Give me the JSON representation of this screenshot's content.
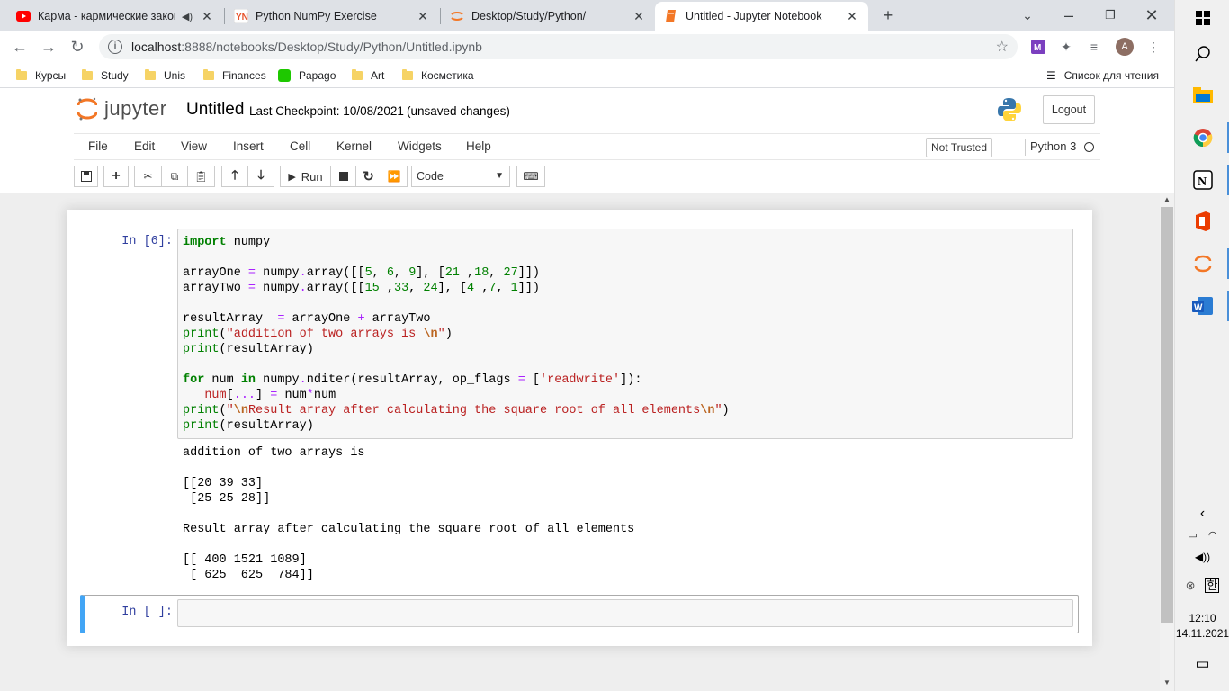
{
  "browser": {
    "tabs": [
      {
        "title": "Карма - кармические закон",
        "icon": "youtube-icon",
        "active": false
      },
      {
        "title": "Python NumPy Exercise",
        "icon": "pynative-icon",
        "active": false
      },
      {
        "title": "Desktop/Study/Python/",
        "icon": "jupyter-icon",
        "active": false
      },
      {
        "title": "Untitled - Jupyter Notebook",
        "icon": "notebook-icon",
        "active": true
      }
    ],
    "url_host": "localhost",
    "url_rest": ":8888/notebooks/Desktop/Study/Python/Untitled.ipynb",
    "avatar_letter": "A",
    "bookmarks": [
      "Курсы",
      "Study",
      "Unis",
      "Finances",
      "Papago",
      "Art",
      "Косметика"
    ],
    "reading_list": "Список для чтения"
  },
  "jupyter": {
    "logo_text": "jupyter",
    "notebook_name": "Untitled",
    "checkpoint": "Last Checkpoint: 10/08/2021",
    "unsaved": "(unsaved changes)",
    "logout": "Logout",
    "menu": [
      "File",
      "Edit",
      "View",
      "Insert",
      "Cell",
      "Kernel",
      "Widgets",
      "Help"
    ],
    "trust": "Not Trusted",
    "kernel": "Python 3",
    "run_label": "Run",
    "cell_type": "Code"
  },
  "cells": [
    {
      "prompt": "In [6]:",
      "output": "addition of two arrays is\n\n[[20 39 33]\n [25 25 28]]\n\nResult array after calculating the square root of all elements\n\n[[ 400 1521 1089]\n [ 625  625  784]]"
    },
    {
      "prompt": "In [ ]:"
    }
  ],
  "taskbar": {
    "time": "12:10",
    "date": "14.11.2021",
    "ime": "한"
  },
  "colors": {
    "prompt_blue": "#303f9f",
    "selected_cell_accent": "#42a5f5",
    "keyword_green": "#008000",
    "string_red": "#ba2121"
  }
}
